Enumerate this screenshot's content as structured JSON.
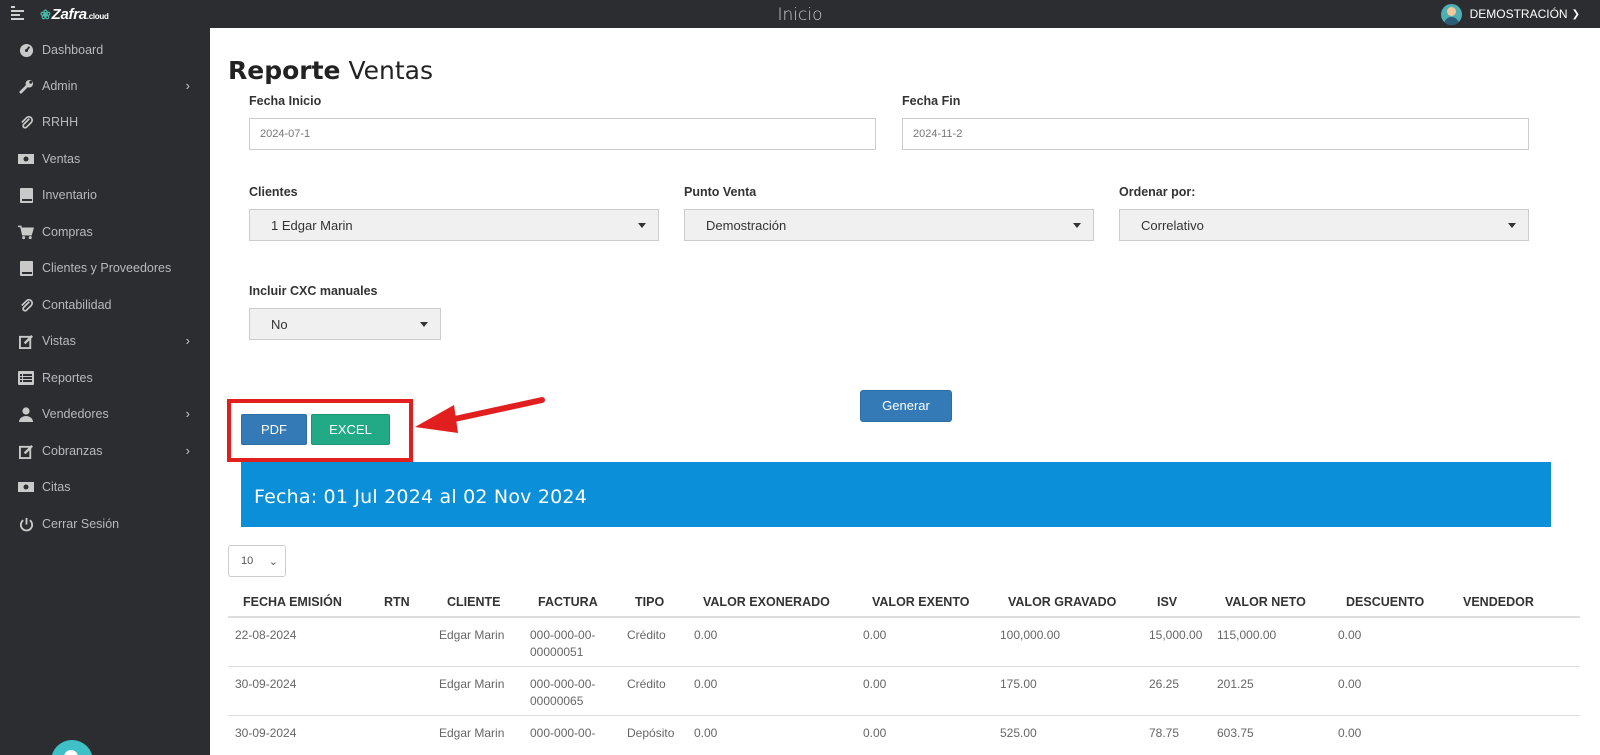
{
  "topbar": {
    "brand": "Zafra",
    "brand_suffix": ".cloud",
    "title": "Inicio",
    "user_name": "DEMOSTRACIÓN"
  },
  "sidebar": {
    "items": [
      {
        "label": "Dashboard",
        "icon": "dashboard-icon",
        "has_submenu": false
      },
      {
        "label": "Admin",
        "icon": "wrench-icon",
        "has_submenu": true
      },
      {
        "label": "RRHH",
        "icon": "paperclip-icon",
        "has_submenu": false
      },
      {
        "label": "Ventas",
        "icon": "money-icon",
        "has_submenu": false
      },
      {
        "label": "Inventario",
        "icon": "book-icon",
        "has_submenu": false
      },
      {
        "label": "Compras",
        "icon": "cart-icon",
        "has_submenu": false
      },
      {
        "label": "Clientes y Proveedores",
        "icon": "book-icon",
        "has_submenu": false
      },
      {
        "label": "Contabilidad",
        "icon": "paperclip-icon",
        "has_submenu": false
      },
      {
        "label": "Vistas",
        "icon": "edit-icon",
        "has_submenu": true
      },
      {
        "label": "Reportes",
        "icon": "list-icon",
        "has_submenu": false
      },
      {
        "label": "Vendedores",
        "icon": "user-icon",
        "has_submenu": true
      },
      {
        "label": "Cobranzas",
        "icon": "edit-icon",
        "has_submenu": true
      },
      {
        "label": "Citas",
        "icon": "money-icon",
        "has_submenu": false
      },
      {
        "label": "Cerrar Sesión",
        "icon": "power-icon",
        "has_submenu": false
      }
    ]
  },
  "page": {
    "title_bold": "Reporte",
    "title_rest": "Ventas"
  },
  "form": {
    "fecha_inicio_label": "Fecha Inicio",
    "fecha_inicio_value": "2024-07-1",
    "fecha_fin_label": "Fecha Fin",
    "fecha_fin_value": "2024-11-2",
    "clientes_label": "Clientes",
    "clientes_value": "1 Edgar Marin",
    "punto_venta_label": "Punto Venta",
    "punto_venta_value": "Demostración",
    "ordenar_label": "Ordenar por:",
    "ordenar_value": "Correlativo",
    "cxc_label": "Incluir CXC manuales",
    "cxc_value": "No",
    "generar_label": "Generar"
  },
  "export": {
    "pdf_label": "PDF",
    "excel_label": "EXCEL"
  },
  "banner": {
    "text": "Fecha: 01 Jul 2024 al 02 Nov 2024"
  },
  "table": {
    "page_size": "10",
    "columns": [
      "FECHA EMISIÓN",
      "RTN",
      "CLIENTE",
      "FACTURA",
      "TIPO",
      "VALOR EXONERADO",
      "VALOR EXENTO",
      "VALOR GRAVADO",
      "ISV",
      "VALOR NETO",
      "DESCUENTO",
      "VENDEDOR"
    ],
    "rows": [
      {
        "fecha": "22-08-2024",
        "rtn": "",
        "cliente": "Edgar Marin",
        "factura_1": "000-000-00-",
        "factura_2": "00000051",
        "tipo": "Crédito",
        "exonerado": "0.00",
        "exento": "0.00",
        "gravado": "100,000.00",
        "isv": "15,000.00",
        "neto": "115,000.00",
        "descuento": "0.00",
        "vendedor": ""
      },
      {
        "fecha": "30-09-2024",
        "rtn": "",
        "cliente": "Edgar Marin",
        "factura_1": "000-000-00-",
        "factura_2": "00000065",
        "tipo": "Crédito",
        "exonerado": "0.00",
        "exento": "0.00",
        "gravado": "175.00",
        "isv": "26.25",
        "neto": "201.25",
        "descuento": "0.00",
        "vendedor": ""
      },
      {
        "fecha": "30-09-2024",
        "rtn": "",
        "cliente": "Edgar Marin",
        "factura_1": "000-000-00-",
        "factura_2": "",
        "tipo": "Depósito",
        "exonerado": "0.00",
        "exento": "0.00",
        "gravado": "525.00",
        "isv": "78.75",
        "neto": "603.75",
        "descuento": "0.00",
        "vendedor": ""
      }
    ]
  },
  "colors": {
    "sidebar_bg": "#2b2d31",
    "primary": "#337ab7",
    "success": "#22aa86",
    "banner": "#0a8fd8",
    "highlight": "#e21f1f"
  }
}
